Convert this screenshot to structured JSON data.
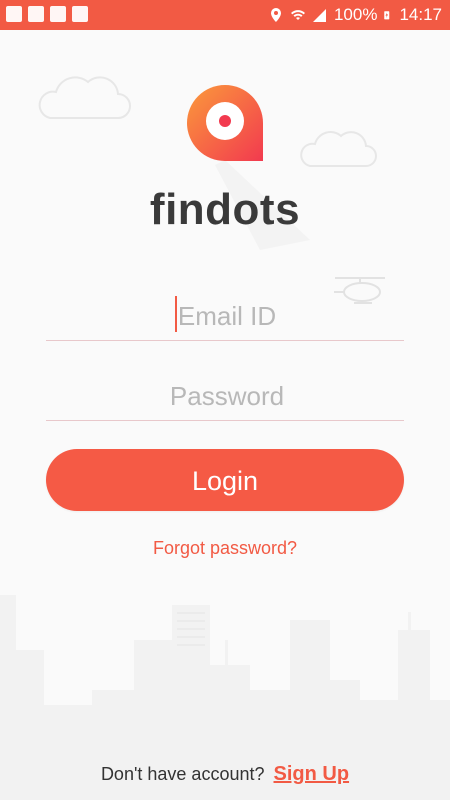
{
  "status_bar": {
    "battery": "100%",
    "time": "14:17",
    "left_icons": [
      "gallery-icon",
      "gmail-icon",
      "check-icon",
      "play-store-icon"
    ],
    "right_icons": [
      "location-icon",
      "wifi-icon",
      "signal-icon",
      "battery-charging-icon"
    ]
  },
  "brand": {
    "name": "findots"
  },
  "login_form": {
    "email_placeholder": "Email ID",
    "email_value": "",
    "password_placeholder": "Password",
    "password_value": "",
    "login_label": "Login",
    "forgot_label": "Forgot password?"
  },
  "footer": {
    "prompt": "Don't have account?",
    "signup_label": "Sign Up"
  },
  "colors": {
    "accent": "#f25a44",
    "status_bar": "#f25a44",
    "background": "#fafafa",
    "brand_text": "#3a3a3a"
  }
}
